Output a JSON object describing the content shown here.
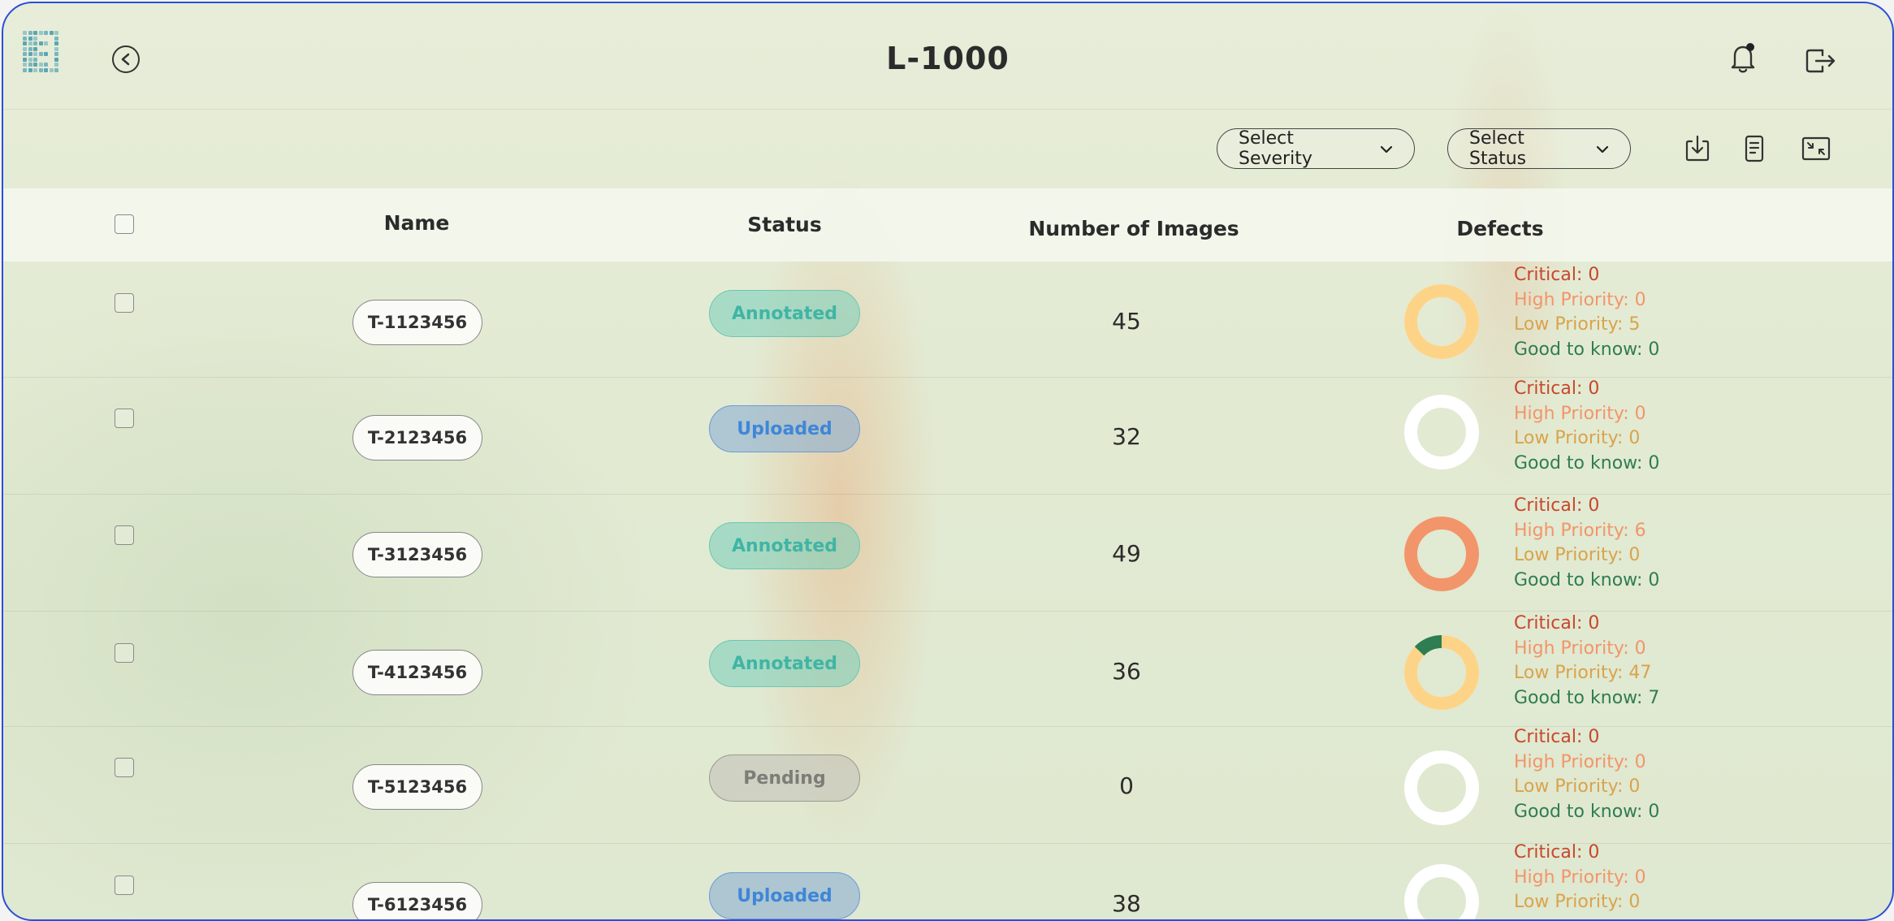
{
  "header": {
    "title": "L-1000"
  },
  "toolbar": {
    "severity_placeholder": "Select Severity",
    "status_placeholder": "Select Status"
  },
  "table": {
    "columns": [
      "Name",
      "Status",
      "Number of Images",
      "Defects"
    ],
    "defect_labels": {
      "critical": "Critical: ",
      "high": "High Priority: ",
      "low": "Low Priority: ",
      "good": "Good to know: "
    },
    "rows": [
      {
        "name": "T-1123456",
        "status": "Annotated",
        "images": "45",
        "critical": 0,
        "high": 0,
        "low": 5,
        "good": 0
      },
      {
        "name": "T-2123456",
        "status": "Uploaded",
        "images": "32",
        "critical": 0,
        "high": 0,
        "low": 0,
        "good": 0
      },
      {
        "name": "T-3123456",
        "status": "Annotated",
        "images": "49",
        "critical": 0,
        "high": 6,
        "low": 0,
        "good": 0
      },
      {
        "name": "T-4123456",
        "status": "Annotated",
        "images": "36",
        "critical": 0,
        "high": 0,
        "low": 47,
        "good": 7
      },
      {
        "name": "T-5123456",
        "status": "Pending",
        "images": "0",
        "critical": 0,
        "high": 0,
        "low": 0,
        "good": 0
      },
      {
        "name": "T-6123456",
        "status": "Uploaded",
        "images": "38",
        "critical": 0,
        "high": 0,
        "low": 0,
        "good": null
      }
    ]
  },
  "colors": {
    "critical": "#c8472a",
    "high": "#f2956a",
    "low": "#fdd487",
    "good": "#2f7d52",
    "empty_ring": "#ffffff",
    "frame_border": "#2b4fd8"
  }
}
